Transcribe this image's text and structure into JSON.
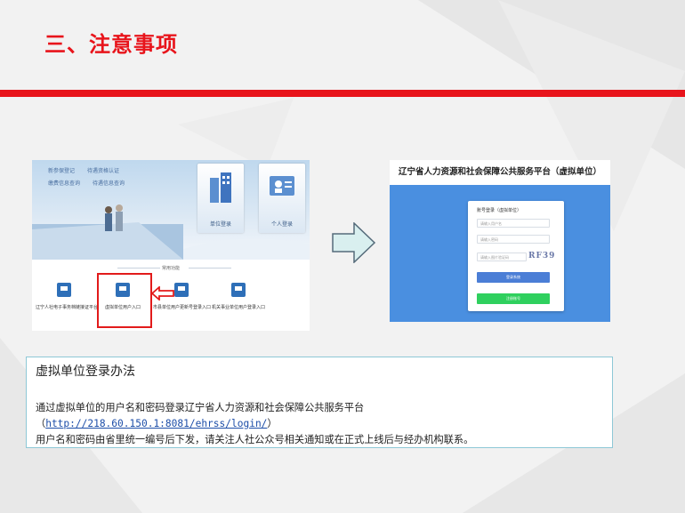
{
  "slide": {
    "title": "三、注意事项",
    "accent_color": "#e8141b"
  },
  "left_screenshot": {
    "menu_items": [
      [
        "新参保登记",
        "待遇资格认证"
      ],
      [
        "缴费信息查询",
        "待遇信息查询"
      ]
    ],
    "tiles": [
      {
        "label": "单位登录",
        "icon": "buildings-icon"
      },
      {
        "label": "个人登录",
        "icon": "person-card-icon"
      }
    ],
    "section_label": "常用功能",
    "entries": [
      {
        "label": "辽宁人社电子事务档链接证平台",
        "icon": "monitor-icon"
      },
      {
        "label": "虚拟单位用户入口",
        "icon": "monitor-icon"
      },
      {
        "label": "市县单位用户更新号登录入口",
        "icon": "monitor-icon"
      },
      {
        "label": "机关事业单位用户登录入口",
        "icon": "monitor-icon"
      }
    ]
  },
  "right_screenshot": {
    "header": "辽宁省人力资源和社会保障公共服务平台（虚拟单位）",
    "login": {
      "title": "账号登录（虚拟单位）",
      "username_placeholder": "请输入用户名",
      "password_placeholder": "请输入密码",
      "captcha_placeholder": "请输入图片验证码",
      "captcha": "RF39",
      "login_button": "登录系统",
      "register_button": "注册账号"
    }
  },
  "note": {
    "title": "虚拟单位登录办法",
    "line1": "通过虚拟单位的用户名和密码登录辽宁省人力资源和社会保障公共服务平台",
    "url_open": "（",
    "url": "http://218.60.150.1:8081/ehrss/login/",
    "url_close": "）",
    "line3": "用户名和密码由省里统一编号后下发，请关注人社公众号相关通知或在正式上线后与经办机构联系。"
  }
}
